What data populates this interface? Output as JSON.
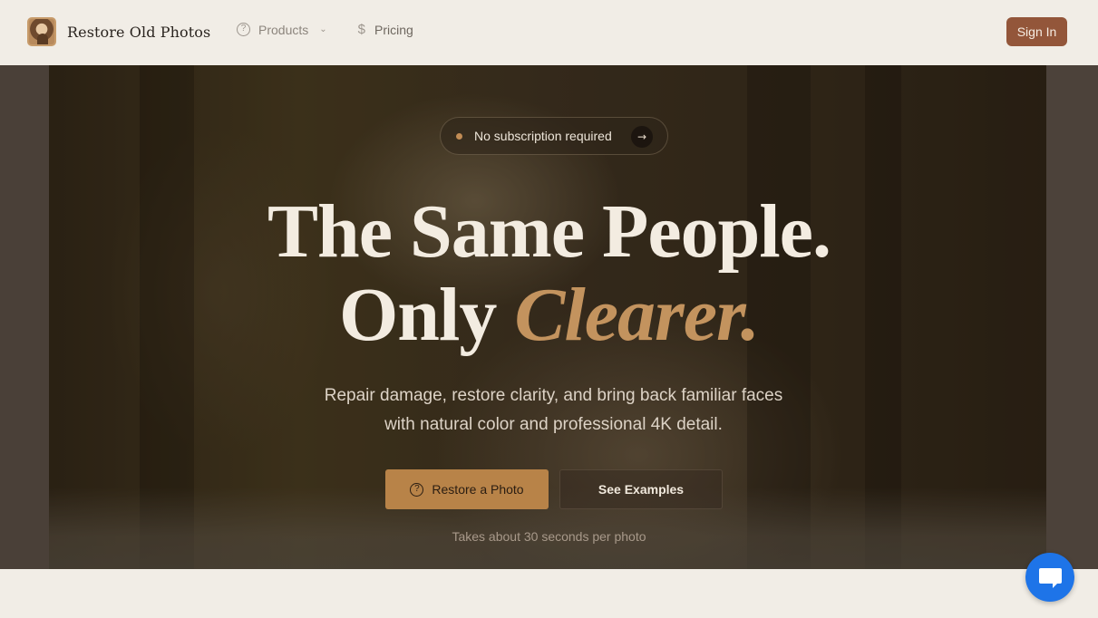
{
  "brand": {
    "name": "Restore Old Photos",
    "logo_icon": "portrait-photo-icon"
  },
  "nav": {
    "items": [
      {
        "label": "Products",
        "icon": "question-circle-icon",
        "has_dropdown": true
      },
      {
        "label": "Pricing",
        "icon": "dollar-icon"
      }
    ]
  },
  "header": {
    "signin_label": "Sign In"
  },
  "hero": {
    "badge_text": "No subscription required",
    "badge_icon": "arrow-right-icon",
    "headline_line1": "The Same People.",
    "headline_line2_plain": "Only",
    "headline_line2_accent": "Clearer.",
    "subtitle": "Repair damage, restore clarity, and bring back familiar faces with natural color and professional 4K detail.",
    "primary_cta": "Restore a Photo",
    "primary_cta_icon": "question-circle-icon",
    "secondary_cta": "See Examples",
    "note": "Takes about 30 seconds per photo"
  },
  "chat_widget": {
    "icon": "chat-bubble-icon"
  },
  "colors": {
    "accent": "#c3935e",
    "signin_bg": "#93563a",
    "primary_cta_bg": "#b88348",
    "chat_bg": "#1e74e8",
    "page_bg": "#f1ede6"
  }
}
